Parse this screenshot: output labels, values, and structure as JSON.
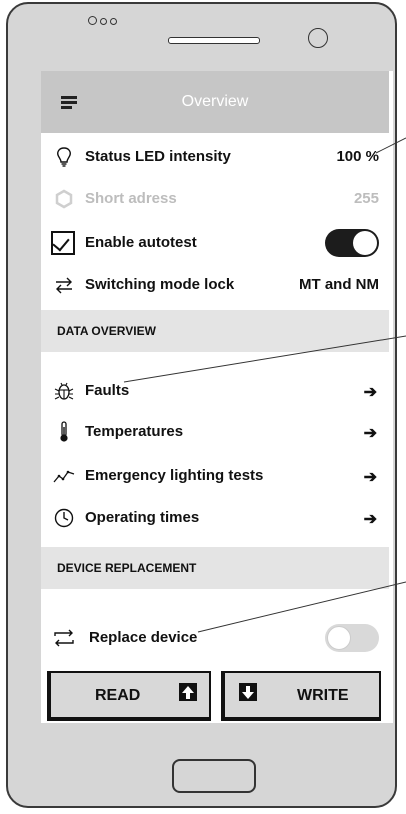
{
  "appbar": {
    "title": "Overview"
  },
  "settings": [
    {
      "label": "Status LED intensity",
      "value": "100 %",
      "icon": "lightbulb-icon"
    },
    {
      "label": "Short adress",
      "value": "255",
      "icon": "diamond-icon",
      "disabled": true
    },
    {
      "label": "Enable autotest",
      "icon": "checkbox-checked-icon",
      "toggle": "on"
    },
    {
      "label": "Switching mode lock",
      "value": "MT and NM",
      "icon": "swap-arrows-icon"
    }
  ],
  "data_overview": {
    "title": "DATA OVERVIEW",
    "items": [
      {
        "label": "Faults",
        "icon": "bug-icon",
        "arrow": "➔"
      },
      {
        "label": "Temperatures",
        "icon": "thermometer-icon",
        "arrow": "➔"
      },
      {
        "label": "Emergency lighting tests",
        "icon": "line-chart-icon",
        "arrow": "➔"
      },
      {
        "label": "Operating times",
        "icon": "clock-icon",
        "arrow": "➔"
      }
    ]
  },
  "device_replacement": {
    "title": "DEVICE REPLACEMENT",
    "item": {
      "label": "Replace device",
      "icon": "replace-arrows-icon",
      "toggle": "off"
    }
  },
  "buttons": {
    "read": {
      "label": "READ",
      "icon": "upload-arrow-icon"
    },
    "write": {
      "label": "WRITE",
      "icon": "download-arrow-icon"
    }
  },
  "colors": {
    "appbar": "#c6c6c6",
    "section": "#e4e4e4",
    "disabled_text": "#bdbdbd"
  }
}
